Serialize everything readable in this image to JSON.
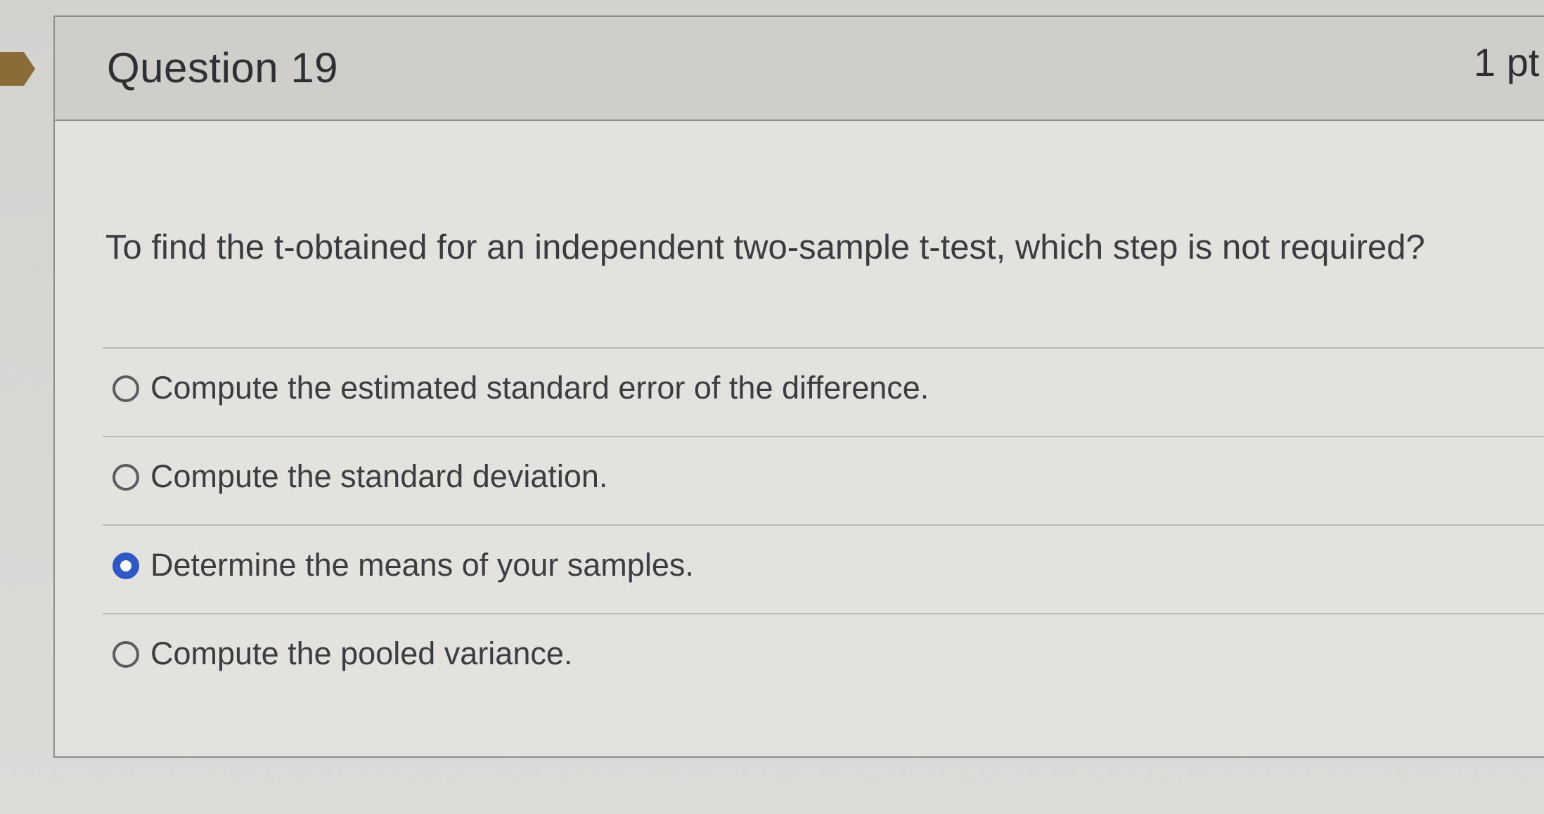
{
  "question": {
    "title": "Question 19",
    "points": "1 pt",
    "text": "To find the t-obtained for an independent two-sample t-test, which step is not required?",
    "flag_color": "#8a6c38"
  },
  "answers": [
    {
      "label": "Compute the estimated standard error of the difference.",
      "selected": false
    },
    {
      "label": "Compute the standard deviation.",
      "selected": false
    },
    {
      "label": "Determine the means of your samples.",
      "selected": true
    },
    {
      "label": "Compute the pooled variance.",
      "selected": false
    }
  ],
  "colors": {
    "selected_radio": "#2f58c4"
  }
}
